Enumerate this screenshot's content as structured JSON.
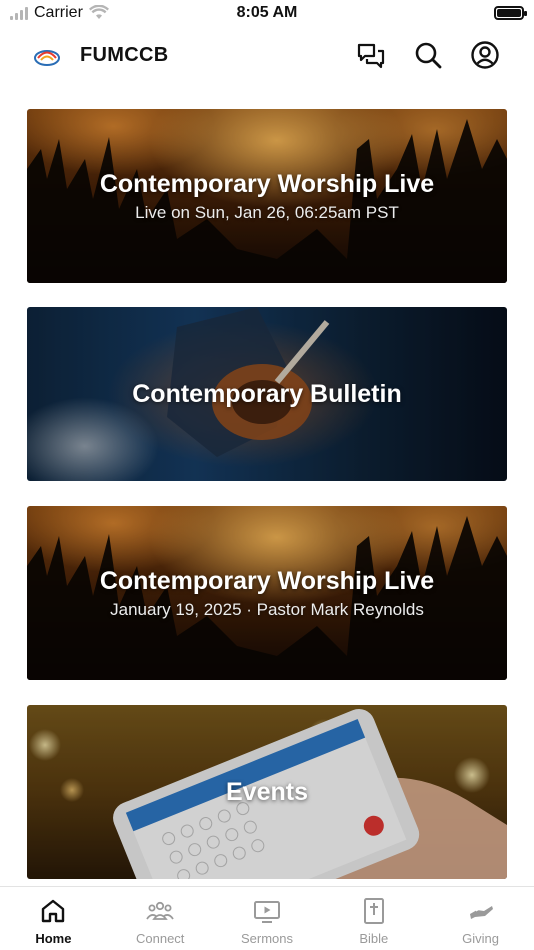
{
  "status_bar": {
    "carrier": "Carrier",
    "time": "8:05 AM"
  },
  "header": {
    "title": "FUMCCB",
    "icons": [
      "chat-icon",
      "search-icon",
      "account-icon"
    ]
  },
  "cards": [
    {
      "title": "Contemporary Worship Live",
      "subtitle": "Live on Sun, Jan 26, 06:25am PST"
    },
    {
      "title": "Contemporary Bulletin",
      "subtitle": ""
    },
    {
      "title": "Contemporary Worship Live",
      "subtitle": "January 19, 2025 · Pastor Mark Reynolds"
    },
    {
      "title": "Events",
      "subtitle": ""
    }
  ],
  "tabs": [
    {
      "label": "Home",
      "icon": "home-icon",
      "active": true
    },
    {
      "label": "Connect",
      "icon": "people-icon",
      "active": false
    },
    {
      "label": "Sermons",
      "icon": "tv-icon",
      "active": false
    },
    {
      "label": "Bible",
      "icon": "bible-icon",
      "active": false
    },
    {
      "label": "Giving",
      "icon": "giving-icon",
      "active": false
    }
  ],
  "colors": {
    "active_tab": "#111111",
    "inactive_tab": "#9a9a9a",
    "background": "#ffffff"
  }
}
